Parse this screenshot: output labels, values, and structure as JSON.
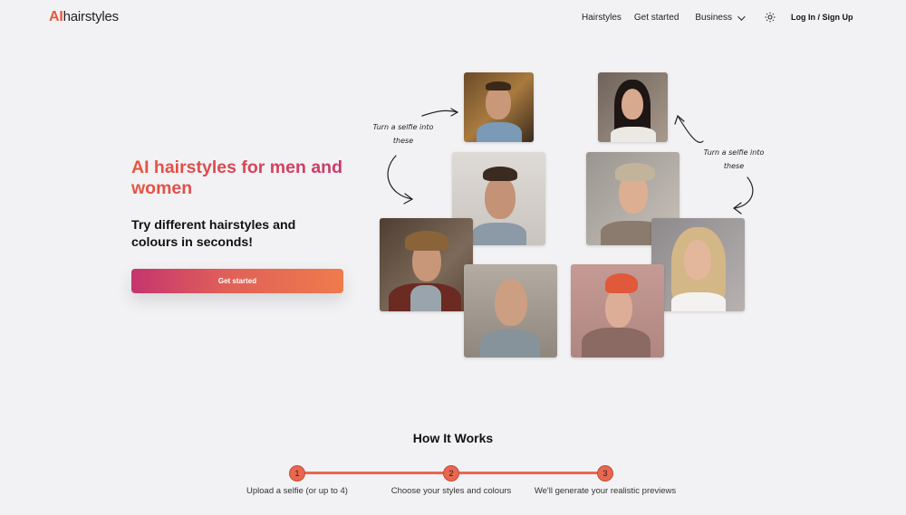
{
  "header": {
    "logo_ai": "AI",
    "logo_rest": "hairstyles",
    "nav": {
      "hairstyles": "Hairstyles",
      "get_started": "Get started",
      "business": "Business"
    },
    "login": "Log In / Sign Up"
  },
  "hero": {
    "title": "AI hairstyles for men and women",
    "subtitle": "Try different hairstyles and colours in seconds!",
    "cta": "Get started"
  },
  "collage": {
    "annotation_left": "Turn a selfie into these",
    "annotation_right": "Turn a selfie into these"
  },
  "how_it_works": {
    "title": "How It Works",
    "steps": [
      {
        "number": "1",
        "label": "Upload a selfie (or up to 4)"
      },
      {
        "number": "2",
        "label": "Choose your styles and colours"
      },
      {
        "number": "3",
        "label": "We'll generate your realistic previews"
      }
    ]
  },
  "colors": {
    "accent": "#e8674f",
    "brand_gradient_start": "#c4356e",
    "brand_gradient_end": "#ef7b4c"
  }
}
